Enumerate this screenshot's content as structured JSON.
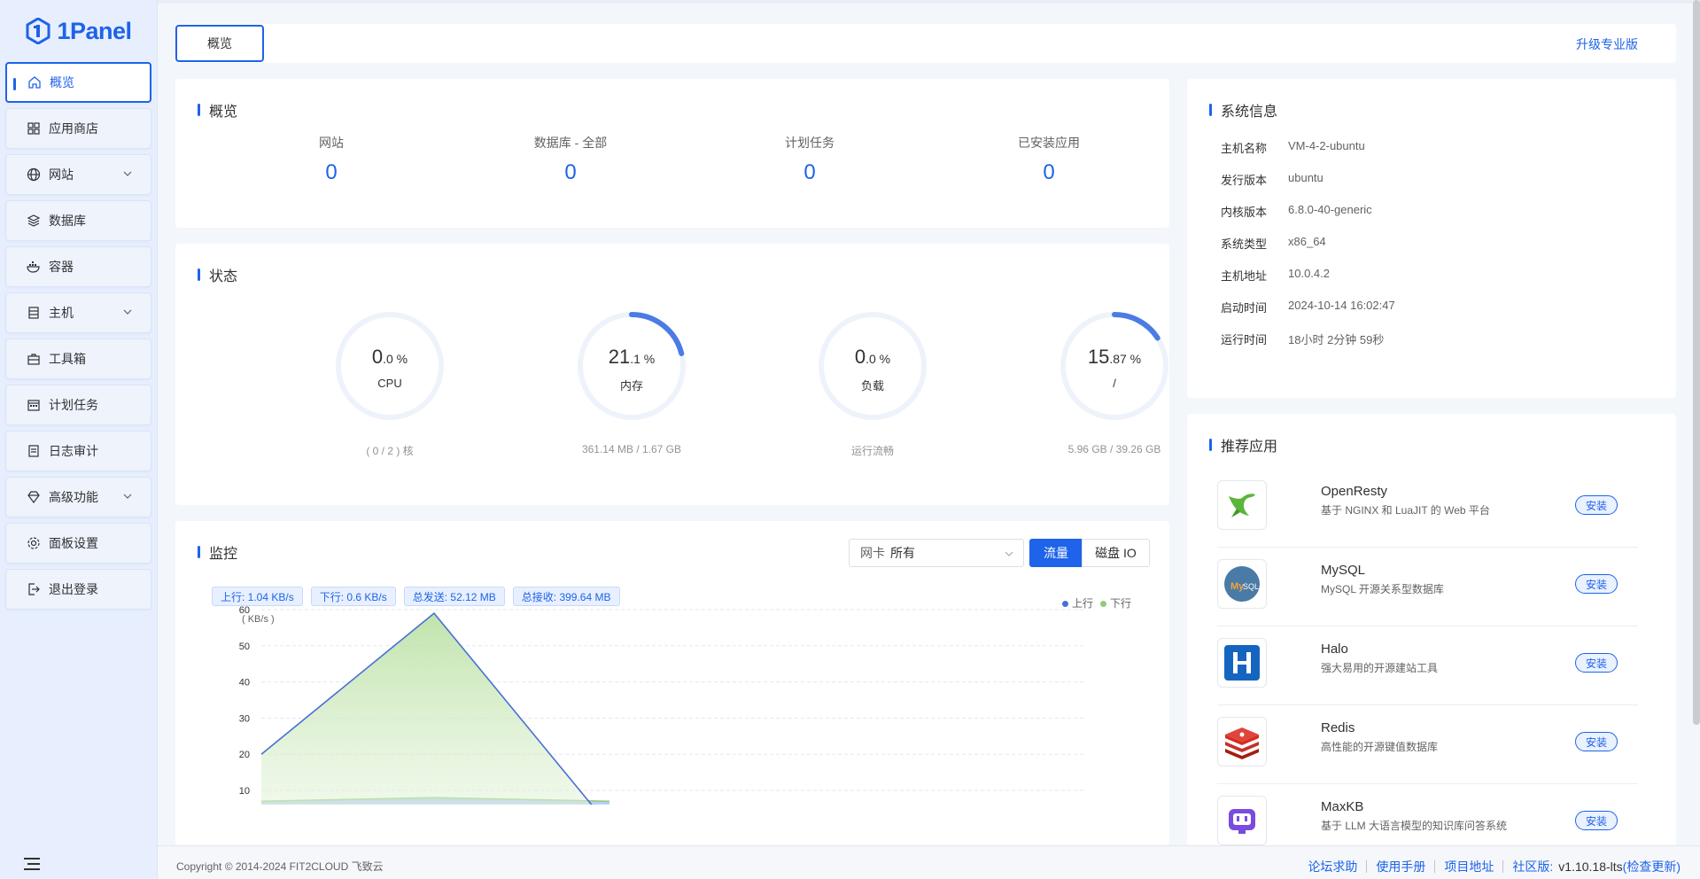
{
  "brand": {
    "name": "1Panel",
    "color": "#1e63e9"
  },
  "sidebar": {
    "items": [
      {
        "label": "概览",
        "icon": "home-icon",
        "active": true
      },
      {
        "label": "应用商店",
        "icon": "grid-icon"
      },
      {
        "label": "网站",
        "icon": "globe-icon",
        "expandable": true
      },
      {
        "label": "数据库",
        "icon": "layers-icon"
      },
      {
        "label": "容器",
        "icon": "docker-icon"
      },
      {
        "label": "主机",
        "icon": "server-icon",
        "expandable": true
      },
      {
        "label": "工具箱",
        "icon": "toolbox-icon"
      },
      {
        "label": "计划任务",
        "icon": "calendar-icon"
      },
      {
        "label": "日志审计",
        "icon": "log-icon"
      },
      {
        "label": "高级功能",
        "icon": "diamond-icon",
        "expandable": true
      },
      {
        "label": "面板设置",
        "icon": "gear-icon"
      },
      {
        "label": "退出登录",
        "icon": "logout-icon"
      }
    ]
  },
  "topbar": {
    "tab_label": "概览",
    "upgrade_label": "升级专业版"
  },
  "overview": {
    "title": "概览",
    "items": [
      {
        "label": "网站",
        "value": "0"
      },
      {
        "label": "数据库 - 全部",
        "value": "0"
      },
      {
        "label": "计划任务",
        "value": "0"
      },
      {
        "label": "已安装应用",
        "value": "0"
      }
    ]
  },
  "status": {
    "title": "状态",
    "gauges": [
      {
        "int": "0",
        "dec": ".0 %",
        "name": "CPU",
        "sub": "( 0 / 2 ) 核",
        "percent": 0.0
      },
      {
        "int": "21",
        "dec": ".1 %",
        "name": "内存",
        "sub": "361.14 MB / 1.67 GB",
        "percent": 21.1
      },
      {
        "int": "0",
        "dec": ".0 %",
        "name": "负载",
        "sub": "运行流畅",
        "percent": 0.0
      },
      {
        "int": "15",
        "dec": ".87 %",
        "name": "/",
        "sub": "5.96 GB / 39.26 GB",
        "percent": 15.87
      }
    ]
  },
  "monitor": {
    "title": "监控",
    "nic_label": "网卡",
    "nic_value": "所有",
    "seg_traffic": "流量",
    "seg_disk": "磁盘 IO",
    "tags": [
      "上行: 1.04 KB/s",
      "下行: 0.6 KB/s",
      "总发送: 52.12 MB",
      "总接收: 399.64 MB"
    ],
    "legend_up": "上行",
    "legend_down": "下行"
  },
  "chart_data": {
    "type": "area",
    "ylabel": "( KB/s )",
    "y_ticks": [
      10,
      20,
      30,
      40,
      50,
      60
    ],
    "ylim": [
      0,
      60
    ],
    "grid": true,
    "legend": "top-right",
    "series": [
      {
        "name": "上行",
        "color": "#4a6fd6",
        "values": [
          20,
          59,
          0
        ]
      },
      {
        "name": "下行",
        "color": "#91cc75",
        "values": [
          7,
          8,
          7
        ]
      }
    ]
  },
  "sysinfo": {
    "title": "系统信息",
    "rows": [
      {
        "key": "主机名称",
        "value": "VM-4-2-ubuntu"
      },
      {
        "key": "发行版本",
        "value": "ubuntu"
      },
      {
        "key": "内核版本",
        "value": "6.8.0-40-generic"
      },
      {
        "key": "系统类型",
        "value": "x86_64"
      },
      {
        "key": "主机地址",
        "value": "10.0.4.2"
      },
      {
        "key": "启动时间",
        "value": "2024-10-14 16:02:47"
      },
      {
        "key": "运行时间",
        "value": "18小时 2分钟 59秒"
      }
    ]
  },
  "apps": {
    "title": "推荐应用",
    "install_label": "安装",
    "items": [
      {
        "name": "OpenResty",
        "desc": "基于 NGINX 和 LuaJIT 的 Web 平台",
        "icon": "openresty-icon"
      },
      {
        "name": "MySQL",
        "desc": "MySQL 开源关系型数据库",
        "icon": "mysql-icon"
      },
      {
        "name": "Halo",
        "desc": "强大易用的开源建站工具",
        "icon": "halo-icon"
      },
      {
        "name": "Redis",
        "desc": "高性能的开源键值数据库",
        "icon": "redis-icon"
      },
      {
        "name": "MaxKB",
        "desc": "基于 LLM 大语言模型的知识库问答系统",
        "icon": "maxkb-icon"
      }
    ]
  },
  "footer": {
    "copyright": "Copyright © 2014-2024 FIT2CLOUD 飞致云",
    "links": [
      "论坛求助",
      "使用手册",
      "项目地址"
    ],
    "version_prefix": "社区版:",
    "version": "v1.10.18-lts",
    "check_update": "(检查更新)"
  }
}
